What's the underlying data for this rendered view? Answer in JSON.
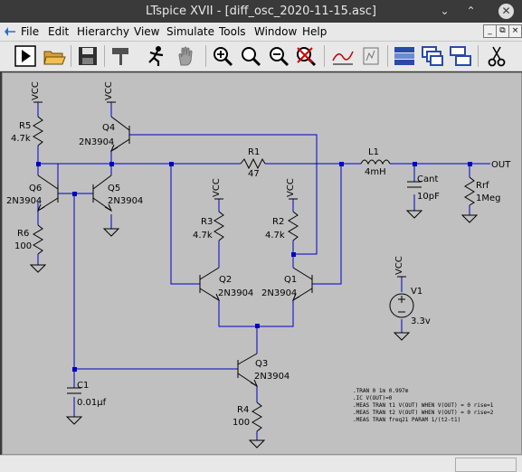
{
  "window": {
    "title": "LTspice XVII - [diff_osc_2020-11-15.asc]"
  },
  "menu": [
    "File",
    "Edit",
    "Hierarchy",
    "View",
    "Simulate",
    "Tools",
    "Window",
    "Help"
  ],
  "toolbar_icons": [
    "run-icon",
    "open-icon",
    "save-icon",
    "control-panel-icon",
    "halt-icon",
    "pan-icon",
    "zoom-in-icon",
    "zoom-area-icon",
    "zoom-out-icon",
    "zoom-cancel-icon",
    "autorange-icon",
    "fft-icon",
    "tile-horizontal-icon",
    "cascade-icon",
    "tile-icon",
    "cut-icon"
  ],
  "mdi_buttons": [
    "_",
    "⧉",
    "×"
  ],
  "components": {
    "R5": {
      "ref": "R5",
      "value": "4.7k"
    },
    "Q4": {
      "ref": "Q4",
      "model": "2N3904"
    },
    "Q6": {
      "ref": "Q6",
      "model": "2N3904"
    },
    "Q5": {
      "ref": "Q5",
      "model": "2N3904"
    },
    "R6": {
      "ref": "R6",
      "value": "100"
    },
    "R1": {
      "ref": "R1",
      "value": "47"
    },
    "L1": {
      "ref": "L1",
      "value": "4mH"
    },
    "Cant": {
      "ref": "Cant",
      "value": "10pF"
    },
    "Rrf": {
      "ref": "Rrf",
      "value": "1Meg"
    },
    "R3": {
      "ref": "R3",
      "value": "4.7k"
    },
    "R2": {
      "ref": "R2",
      "value": "4.7k"
    },
    "Q2": {
      "ref": "Q2",
      "model": "2N3904"
    },
    "Q1": {
      "ref": "Q1",
      "model": "2N3904"
    },
    "V1": {
      "ref": "V1",
      "value": "3.3v"
    },
    "Q3": {
      "ref": "Q3",
      "model": "2N3904"
    },
    "C1": {
      "ref": "C1",
      "value": "0.01µf"
    },
    "R4": {
      "ref": "R4",
      "value": "100"
    }
  },
  "net_labels": {
    "vcc": "VCC",
    "out": "OUT"
  },
  "spice_directives": [
    ".TRAN 0 1m 0.997m",
    ".IC V(OUT)=0",
    ".MEAS TRAN t1 V(OUT) WHEN V(OUT) = 0 rise=1",
    ".MEAS TRAN t2 V(OUT) WHEN V(OUT) = 0 rise=2",
    ".MEAS TRAN freq21 PARAM 1/(t2-t1)"
  ],
  "colors": {
    "wire": "#0000c8",
    "canvas": "#c0c0c0",
    "titlebar": "#3a3a3a"
  }
}
